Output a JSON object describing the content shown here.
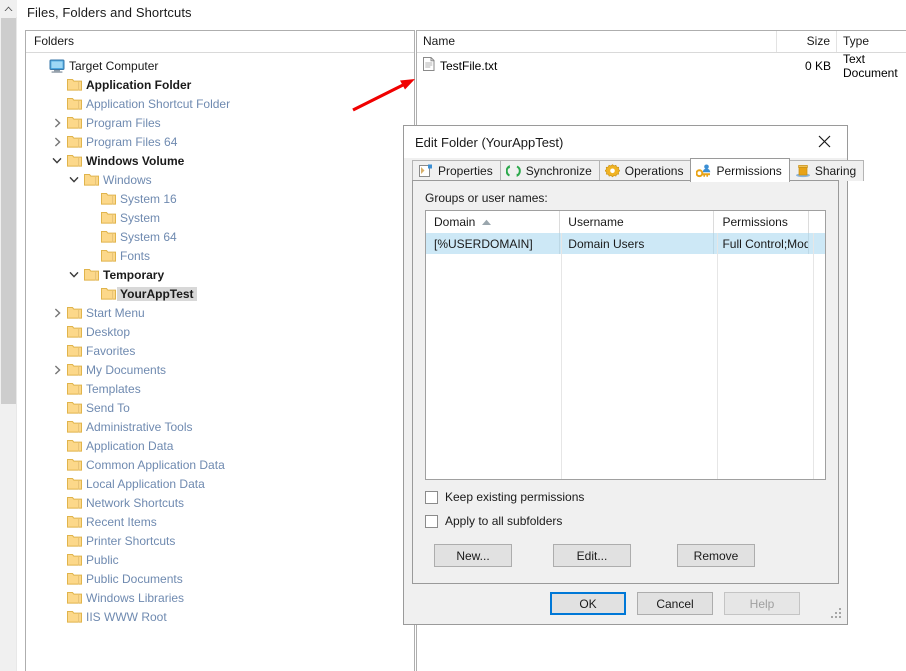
{
  "page": {
    "title": "Files, Folders and Shortcuts"
  },
  "tree_panel": {
    "header": "Folders",
    "items": [
      {
        "label": "Target Computer",
        "icon": "computer-icon",
        "indent": 0,
        "twisty": "none",
        "style": "root"
      },
      {
        "label": "Application Folder",
        "icon": "folder-icon",
        "indent": 1,
        "twisty": "none",
        "style": "bold"
      },
      {
        "label": "Application Shortcut Folder",
        "icon": "folder-icon",
        "indent": 1,
        "twisty": "none",
        "style": "dim"
      },
      {
        "label": "Program Files",
        "icon": "folder-icon",
        "indent": 1,
        "twisty": "collapsed",
        "style": "dim"
      },
      {
        "label": "Program Files 64",
        "icon": "folder-icon",
        "indent": 1,
        "twisty": "collapsed",
        "style": "dim"
      },
      {
        "label": "Windows Volume",
        "icon": "folder-icon",
        "indent": 1,
        "twisty": "expanded",
        "style": "bold"
      },
      {
        "label": "Windows",
        "icon": "folder-icon",
        "indent": 2,
        "twisty": "expanded",
        "style": "dim"
      },
      {
        "label": "System 16",
        "icon": "folder-icon",
        "indent": 3,
        "twisty": "none",
        "style": "dim"
      },
      {
        "label": "System",
        "icon": "folder-icon",
        "indent": 3,
        "twisty": "none",
        "style": "dim"
      },
      {
        "label": "System 64",
        "icon": "folder-icon",
        "indent": 3,
        "twisty": "none",
        "style": "dim"
      },
      {
        "label": "Fonts",
        "icon": "folder-icon",
        "indent": 3,
        "twisty": "none",
        "style": "dim"
      },
      {
        "label": "Temporary",
        "icon": "folder-icon",
        "indent": 2,
        "twisty": "expanded",
        "style": "bold"
      },
      {
        "label": "YourAppTest",
        "icon": "folder-icon",
        "indent": 3,
        "twisty": "none",
        "style": "selected"
      },
      {
        "label": "Start Menu",
        "icon": "folder-icon",
        "indent": 1,
        "twisty": "collapsed",
        "style": "dim"
      },
      {
        "label": "Desktop",
        "icon": "folder-icon",
        "indent": 1,
        "twisty": "none",
        "style": "dim"
      },
      {
        "label": "Favorites",
        "icon": "folder-icon",
        "indent": 1,
        "twisty": "none",
        "style": "dim"
      },
      {
        "label": "My Documents",
        "icon": "folder-icon",
        "indent": 1,
        "twisty": "collapsed",
        "style": "dim"
      },
      {
        "label": "Templates",
        "icon": "folder-icon",
        "indent": 1,
        "twisty": "none",
        "style": "dim"
      },
      {
        "label": "Send To",
        "icon": "folder-icon",
        "indent": 1,
        "twisty": "none",
        "style": "dim"
      },
      {
        "label": "Administrative Tools",
        "icon": "folder-icon",
        "indent": 1,
        "twisty": "none",
        "style": "dim"
      },
      {
        "label": "Application Data",
        "icon": "folder-icon",
        "indent": 1,
        "twisty": "none",
        "style": "dim"
      },
      {
        "label": "Common Application Data",
        "icon": "folder-icon",
        "indent": 1,
        "twisty": "none",
        "style": "dim"
      },
      {
        "label": "Local Application Data",
        "icon": "folder-icon",
        "indent": 1,
        "twisty": "none",
        "style": "dim"
      },
      {
        "label": "Network Shortcuts",
        "icon": "folder-icon",
        "indent": 1,
        "twisty": "none",
        "style": "dim"
      },
      {
        "label": "Recent Items",
        "icon": "folder-icon",
        "indent": 1,
        "twisty": "none",
        "style": "dim"
      },
      {
        "label": "Printer Shortcuts",
        "icon": "folder-icon",
        "indent": 1,
        "twisty": "none",
        "style": "dim"
      },
      {
        "label": "Public",
        "icon": "folder-icon",
        "indent": 1,
        "twisty": "none",
        "style": "dim"
      },
      {
        "label": "Public Documents",
        "icon": "folder-icon",
        "indent": 1,
        "twisty": "none",
        "style": "dim"
      },
      {
        "label": "Windows Libraries",
        "icon": "folder-icon",
        "indent": 1,
        "twisty": "none",
        "style": "dim"
      },
      {
        "label": "IIS WWW Root",
        "icon": "folder-icon",
        "indent": 1,
        "twisty": "none",
        "style": "dim"
      }
    ]
  },
  "file_list": {
    "columns": [
      "Name",
      "Size",
      "Type"
    ],
    "rows": [
      {
        "name": "TestFile.txt",
        "size": "0 KB",
        "type": "Text Document",
        "icon": "text-file-icon"
      }
    ]
  },
  "dialog": {
    "title": "Edit Folder (YourAppTest)",
    "close_label": "✕",
    "tabs": [
      {
        "label": "Properties",
        "icon": "properties-icon",
        "active": false
      },
      {
        "label": "Synchronize",
        "icon": "synchronize-icon",
        "active": false
      },
      {
        "label": "Operations",
        "icon": "operations-icon",
        "active": false
      },
      {
        "label": "Permissions",
        "icon": "permissions-icon",
        "active": true
      },
      {
        "label": "Sharing",
        "icon": "sharing-icon",
        "active": false
      }
    ],
    "permissions": {
      "group_label": "Groups or user names:",
      "columns": [
        "Domain",
        "Username",
        "Permissions",
        ""
      ],
      "sort_column": "Domain",
      "sort_direction": "ascending",
      "rows": [
        {
          "domain": "[%USERDOMAIN]",
          "username": "Domain Users",
          "permissions": "Full Control;Modif...",
          "extra": ""
        }
      ],
      "checkboxes": [
        {
          "label": "Keep existing permissions",
          "checked": false
        },
        {
          "label": "Apply to all subfolders",
          "checked": false
        }
      ],
      "action_buttons": [
        {
          "label": "New...",
          "disabled": false
        },
        {
          "label": "Edit...",
          "disabled": false
        },
        {
          "label": "Remove",
          "disabled": false
        }
      ]
    },
    "footer_buttons": [
      {
        "label": "OK",
        "default": true,
        "disabled": false
      },
      {
        "label": "Cancel",
        "default": false,
        "disabled": false
      },
      {
        "label": "Help",
        "default": false,
        "disabled": true
      }
    ]
  },
  "colors": {
    "accent": "#0078d7",
    "selection": "#cde8f6",
    "tree_dim_text": "#6f8ab0",
    "folder_icon": "#fcd88a",
    "annotation": "#f00000"
  }
}
